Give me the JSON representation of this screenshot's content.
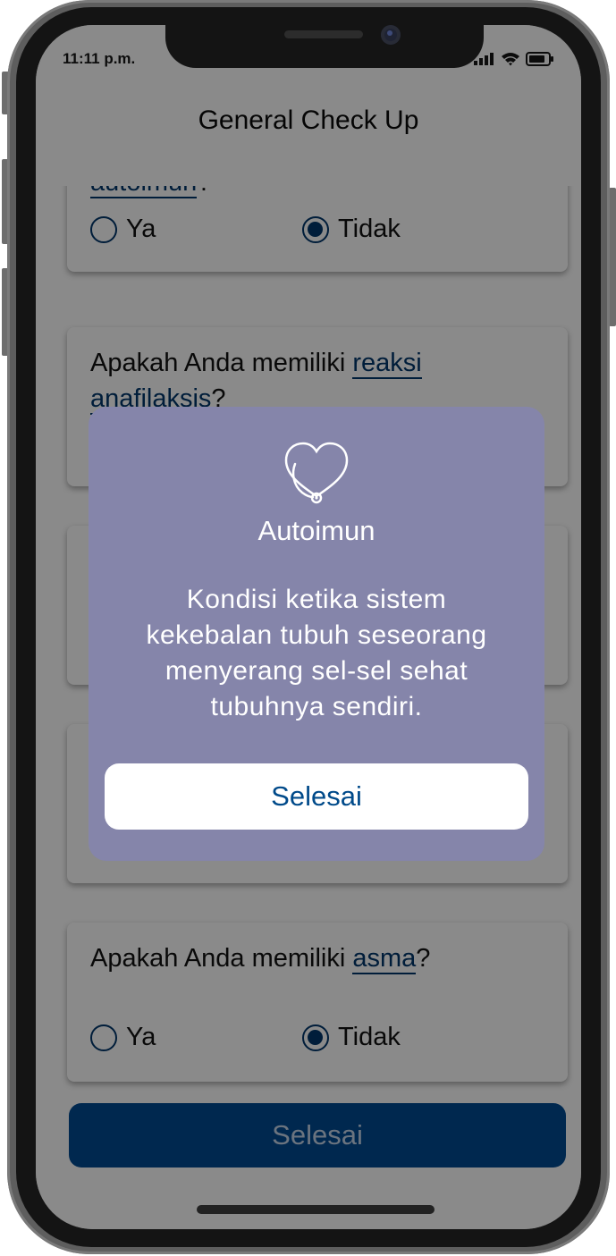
{
  "status_bar": {
    "time": "11:11 p.m."
  },
  "app": {
    "title": "General Check Up"
  },
  "options": {
    "yes": "Ya",
    "no": "Tidak"
  },
  "questions": [
    {
      "prefix": "",
      "link": "autoimun",
      "suffix": "?",
      "selected": "Tidak"
    },
    {
      "prefix": "Apakah Anda memiliki ",
      "link": "reaksi",
      "link2": "anafilaksis",
      "suffix": "?",
      "selected": ""
    },
    {
      "prefix": "Apakah Anda memiliki ",
      "link": "asma",
      "suffix": "?",
      "selected": "Tidak"
    }
  ],
  "footer": {
    "finish_label": "Selesai"
  },
  "modal": {
    "icon": "heart-stethoscope-icon",
    "title": "Autoimun",
    "body": "Kondisi ketika sistem kekebalan tubuh seseorang menyerang sel-sel sehat tubuhnya sendiri.",
    "button_label": "Selesai"
  },
  "colors": {
    "primary": "#004a93",
    "modal_bg": "#8585aa",
    "link": "#00366b"
  }
}
